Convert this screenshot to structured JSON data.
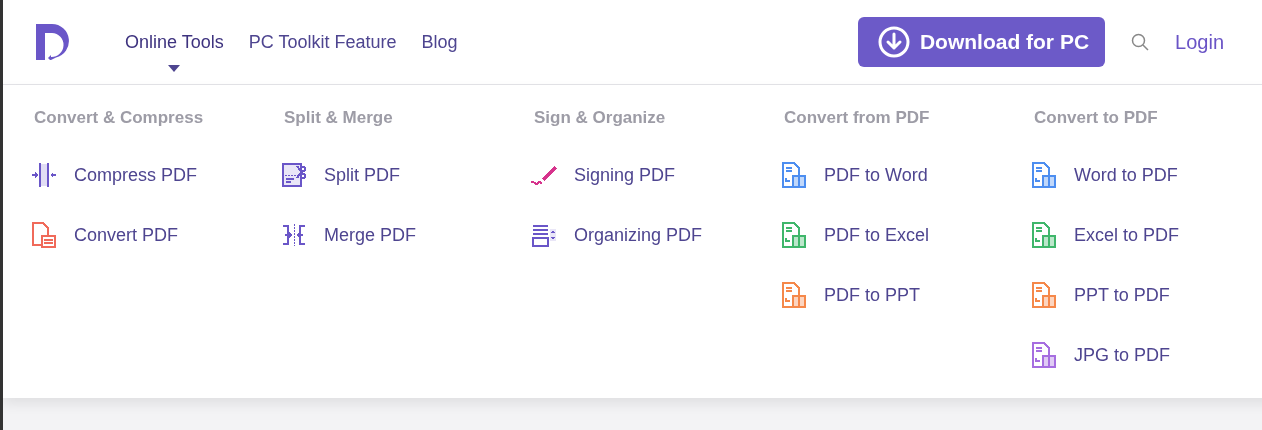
{
  "nav": {
    "items": [
      {
        "label": "Online Tools",
        "selected": true
      },
      {
        "label": "PC Toolkit Feature",
        "selected": false
      },
      {
        "label": "Blog",
        "selected": false
      }
    ],
    "download_button": "Download for PC",
    "login": "Login"
  },
  "menu": [
    {
      "heading": "Convert & Compress",
      "items": [
        {
          "label": "Compress PDF",
          "kind": "compress",
          "color": "#6a56c8"
        },
        {
          "label": "Convert PDF",
          "kind": "convert",
          "color": "#f06a5a"
        }
      ]
    },
    {
      "heading": "Split & Merge",
      "items": [
        {
          "label": "Split PDF",
          "kind": "split",
          "color": "#6a56c8"
        },
        {
          "label": "Merge PDF",
          "kind": "merge",
          "color": "#6a56c8"
        }
      ]
    },
    {
      "heading": "Sign & Organize",
      "items": [
        {
          "label": "Signing PDF",
          "kind": "sign",
          "color": "#d6338c"
        },
        {
          "label": "Organizing PDF",
          "kind": "organize",
          "color": "#6a56c8"
        }
      ]
    },
    {
      "heading": "Convert from PDF",
      "items": [
        {
          "label": "PDF to Word",
          "kind": "file",
          "color": "#4d8ef0"
        },
        {
          "label": "PDF to Excel",
          "kind": "file",
          "color": "#3fb66b"
        },
        {
          "label": "PDF to PPT",
          "kind": "file",
          "color": "#f5884a"
        }
      ]
    },
    {
      "heading": "Convert to PDF",
      "items": [
        {
          "label": "Word to PDF",
          "kind": "file",
          "color": "#4d8ef0"
        },
        {
          "label": "Excel to PDF",
          "kind": "file",
          "color": "#3fb66b"
        },
        {
          "label": "PPT to PDF",
          "kind": "file",
          "color": "#f5884a"
        },
        {
          "label": "JPG to PDF",
          "kind": "file",
          "color": "#a66ee0"
        }
      ]
    }
  ]
}
